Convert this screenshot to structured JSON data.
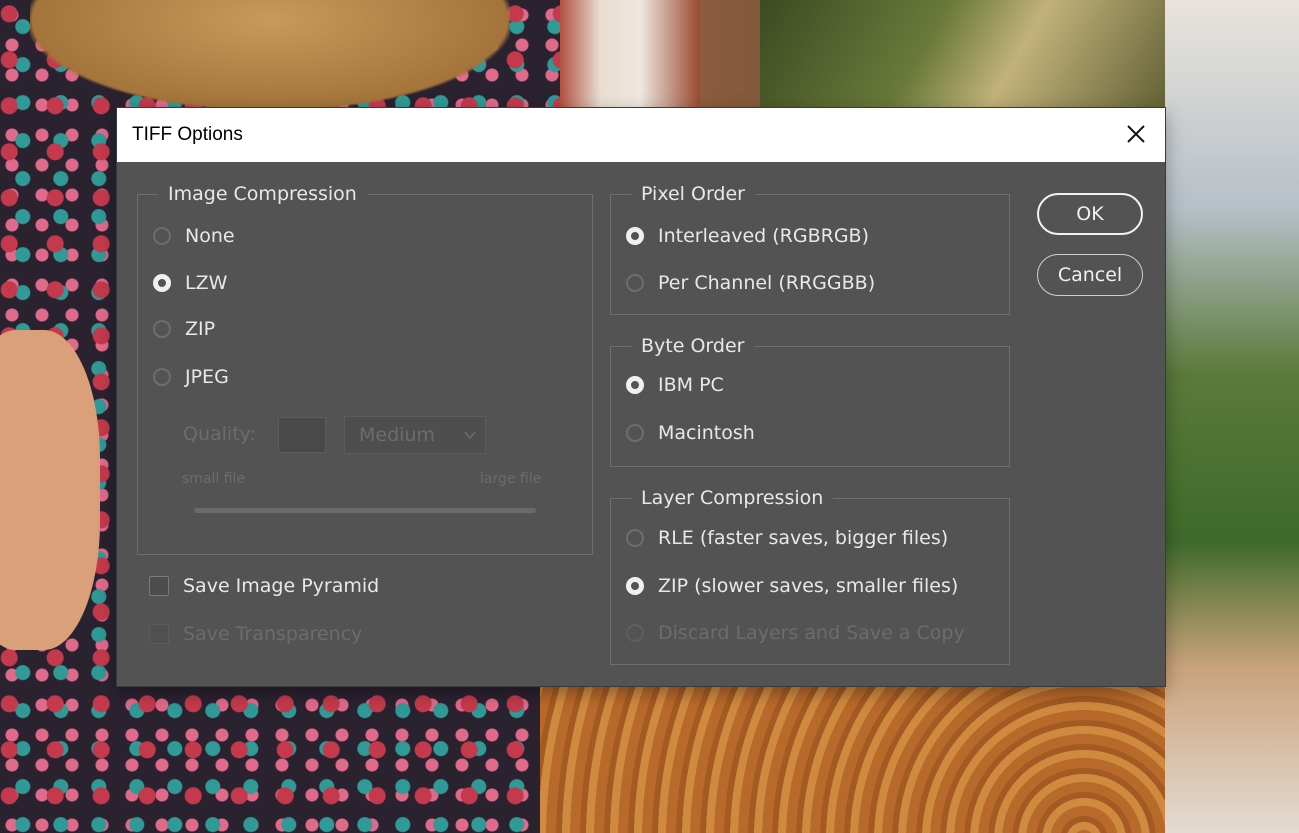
{
  "dialog": {
    "title": "TIFF Options",
    "ok_label": "OK",
    "cancel_label": "Cancel"
  },
  "image_compression": {
    "legend": "Image Compression",
    "options": [
      "None",
      "LZW",
      "ZIP",
      "JPEG"
    ],
    "selected": "LZW",
    "quality_label": "Quality:",
    "quality_value": "",
    "quality_preset": "Medium",
    "small_file_label": "small file",
    "large_file_label": "large file"
  },
  "pixel_order": {
    "legend": "Pixel Order",
    "options": [
      "Interleaved (RGBRGB)",
      "Per Channel (RRGGBB)"
    ],
    "selected": "Interleaved (RGBRGB)"
  },
  "byte_order": {
    "legend": "Byte Order",
    "options": [
      "IBM PC",
      "Macintosh"
    ],
    "selected": "IBM PC"
  },
  "layer_compression": {
    "legend": "Layer Compression",
    "options": [
      "RLE (faster saves, bigger files)",
      "ZIP (slower saves, smaller files)",
      "Discard Layers and Save a Copy"
    ],
    "selected": "ZIP (slower saves, smaller files)"
  },
  "checkboxes": {
    "save_image_pyramid": "Save Image Pyramid",
    "save_transparency": "Save Transparency"
  },
  "icons": {
    "close": "close-icon",
    "dropdown": "chevron-down-icon"
  },
  "colors": {
    "dialog_bg": "#535353",
    "text": "#e8e8e8",
    "disabled_text": "#6c6c6c",
    "border": "#6e6e6e"
  }
}
